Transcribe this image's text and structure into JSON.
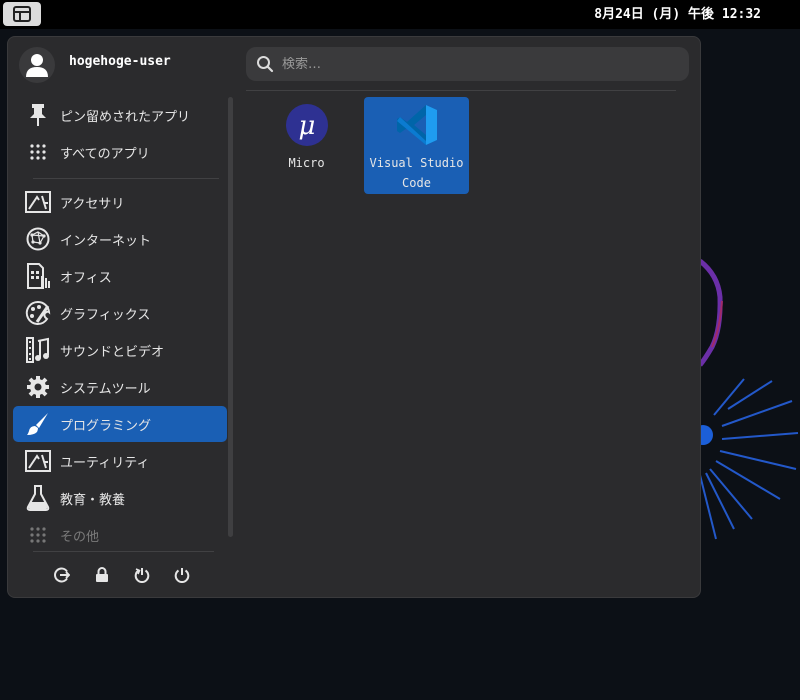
{
  "top_bar": {
    "clock": "8月24日 (月) 午後 12:32",
    "menu_icon": "app-menu-icon"
  },
  "user": {
    "name": "hogehoge-user",
    "avatar_icon": "avatar-icon"
  },
  "search": {
    "placeholder": "検索…",
    "value": ""
  },
  "sidebar": {
    "pinned": [
      {
        "label": "ピン留めされたアプリ",
        "icon": "pin-icon"
      },
      {
        "label": "すべてのアプリ",
        "icon": "grid-icon"
      }
    ],
    "categories": [
      {
        "label": "アクセサリ",
        "icon": "accessories-icon"
      },
      {
        "label": "インターネット",
        "icon": "internet-icon"
      },
      {
        "label": "オフィス",
        "icon": "office-icon"
      },
      {
        "label": "グラフィックス",
        "icon": "graphics-icon"
      },
      {
        "label": "サウンドとビデオ",
        "icon": "multimedia-icon"
      },
      {
        "label": "システムツール",
        "icon": "gear-icon"
      },
      {
        "label": "プログラミング",
        "icon": "brush-icon",
        "active": true
      },
      {
        "label": "ユーティリティ",
        "icon": "utilities-icon"
      },
      {
        "label": "教育・教養",
        "icon": "flask-icon"
      },
      {
        "label": "その他",
        "icon": "grid-icon"
      }
    ]
  },
  "power_buttons": [
    {
      "icon": "logout-icon"
    },
    {
      "icon": "lock-icon"
    },
    {
      "icon": "restart-icon"
    },
    {
      "icon": "power-icon"
    }
  ],
  "apps": [
    {
      "line1": "Micro",
      "line2": "",
      "icon": "micro-icon",
      "selected": false
    },
    {
      "line1": "Visual Studio",
      "line2": "Code",
      "icon": "vscode-icon",
      "selected": true
    }
  ],
  "colors": {
    "accent": "#1a5fb4",
    "panel_bg": "#2b2b2d",
    "top_bar_bg": "#000000"
  }
}
